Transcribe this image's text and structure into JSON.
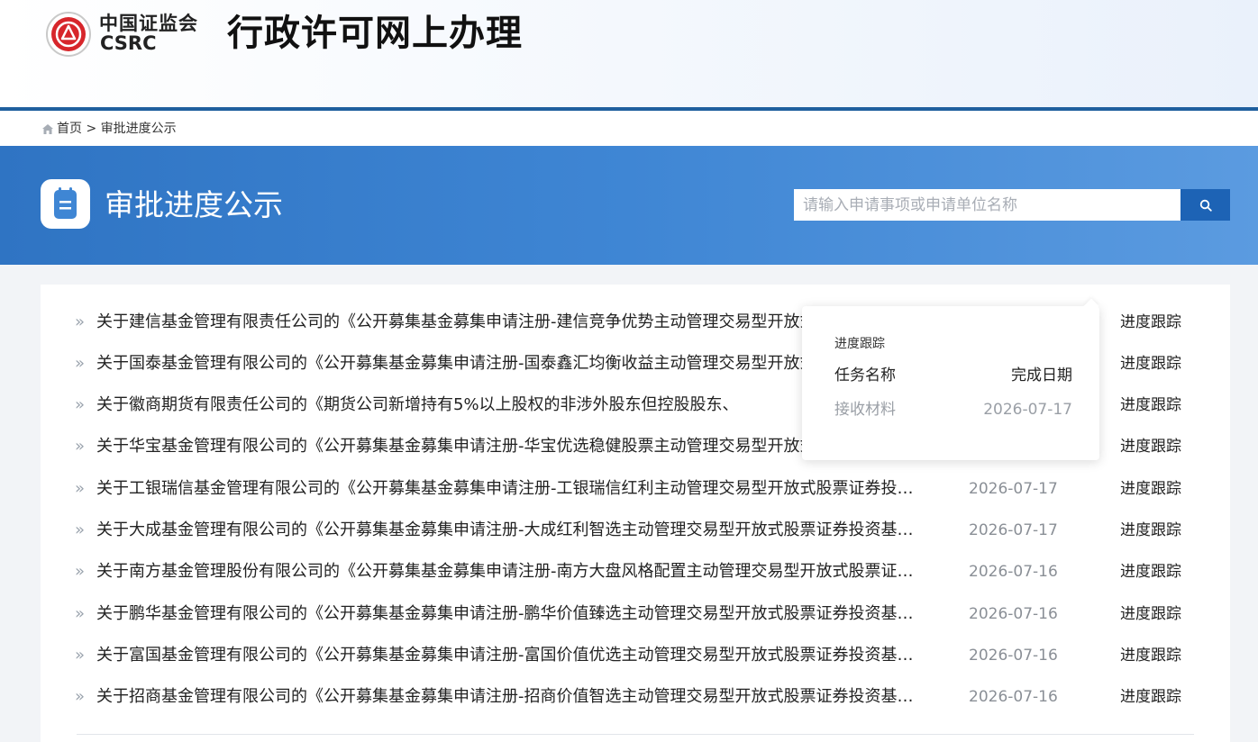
{
  "header": {
    "logo_cn": "中国证监会",
    "logo_en": "CSRC",
    "site_title": "行政许可网上办理"
  },
  "breadcrumb": {
    "home": "首页",
    "separator": ">",
    "current": "审批进度公示"
  },
  "banner": {
    "title": "审批进度公示",
    "icon": "document-list-icon"
  },
  "search": {
    "placeholder": "请输入申请事项或申请单位名称",
    "button_icon": "search-icon"
  },
  "list": {
    "items": [
      {
        "title": "关于建信基金管理有限责任公司的《公开募集基金募集申请注册-建信竞争优势主动管理交易型开放式股票证券投资基金》",
        "date": "",
        "action": "进度跟踪"
      },
      {
        "title": "关于国泰基金管理有限公司的《公开募集基金募集申请注册-国泰鑫汇均衡收益主动管理交易型开放式股票证券投资基金》",
        "date": "",
        "action": "进度跟踪"
      },
      {
        "title": "关于徽商期货有限责任公司的《期货公司新增持有5%以上股权的非涉外股东但控股股东、",
        "date": "",
        "action": "进度跟踪"
      },
      {
        "title": "关于华宝基金管理有限公司的《公开募集基金募集申请注册-华宝优选稳健股票主动管理交易型开放式证券投资基金》",
        "date": "",
        "action": "进度跟踪"
      },
      {
        "title": "关于工银瑞信基金管理有限公司的《公开募集基金募集申请注册-工银瑞信红利主动管理交易型开放式股票证券投资基金》",
        "date": "2026-07-17",
        "action": "进度跟踪"
      },
      {
        "title": "关于大成基金管理有限公司的《公开募集基金募集申请注册-大成红利智选主动管理交易型开放式股票证券投资基金》",
        "date": "2026-07-17",
        "action": "进度跟踪"
      },
      {
        "title": "关于南方基金管理股份有限公司的《公开募集基金募集申请注册-南方大盘风格配置主动管理交易型开放式股票证券投资基金》",
        "date": "2026-07-16",
        "action": "进度跟踪"
      },
      {
        "title": "关于鹏华基金管理有限公司的《公开募集基金募集申请注册-鹏华价值臻选主动管理交易型开放式股票证券投资基金》",
        "date": "2026-07-16",
        "action": "进度跟踪"
      },
      {
        "title": "关于富国基金管理有限公司的《公开募集基金募集申请注册-富国价值优选主动管理交易型开放式股票证券投资基金》",
        "date": "2026-07-16",
        "action": "进度跟踪"
      },
      {
        "title": "关于招商基金管理有限公司的《公开募集基金募集申请注册-招商价值智选主动管理交易型开放式股票证券投资基金》",
        "date": "2026-07-16",
        "action": "进度跟踪"
      }
    ]
  },
  "popover": {
    "title": "进度跟踪",
    "col_task": "任务名称",
    "col_date": "完成日期",
    "task": "接收材料",
    "task_date": "2026-07-17"
  },
  "colors": {
    "banner": "#3f86d4",
    "header_line": "#1f5f9e",
    "search_button": "#1d63b5",
    "logo_red": "#d7262b"
  }
}
